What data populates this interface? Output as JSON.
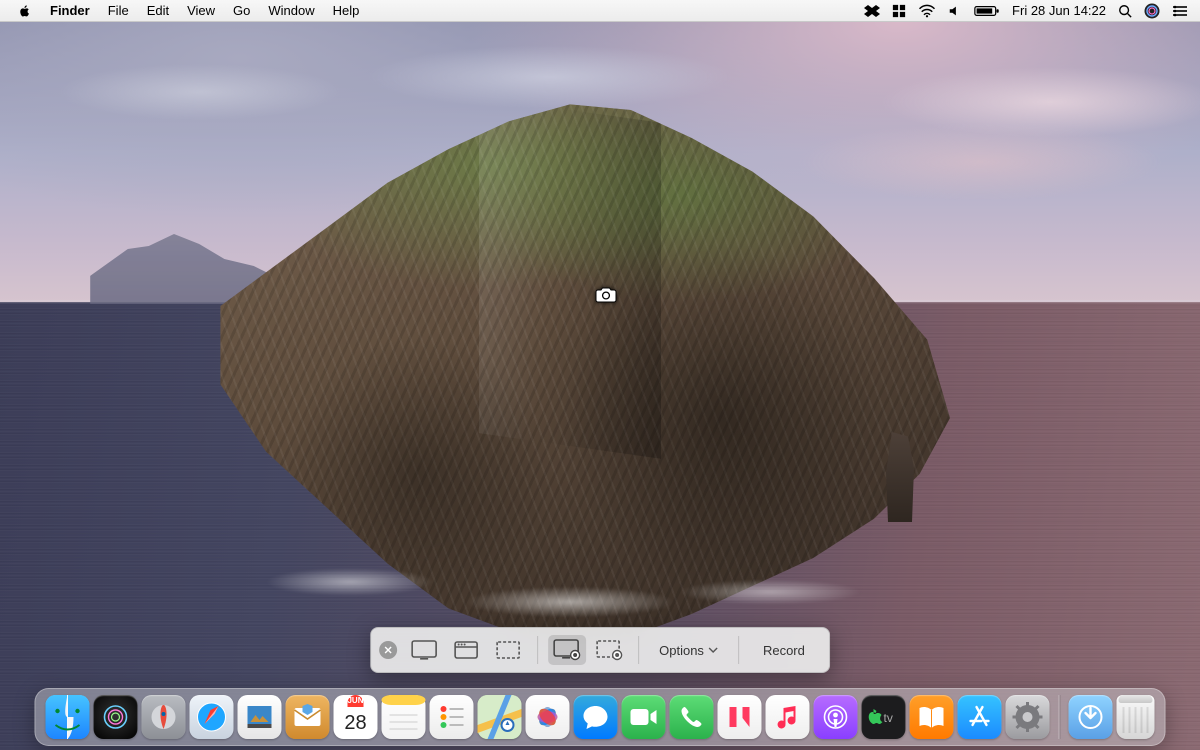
{
  "menubar": {
    "app": "Finder",
    "items": [
      "File",
      "Edit",
      "View",
      "Go",
      "Window",
      "Help"
    ],
    "datetime": "Fri 28 Jun  14:22"
  },
  "screenshot_toolbar": {
    "options_label": "Options",
    "action_label": "Record",
    "selected_mode": "record-entire-screen"
  },
  "calendar_tile": {
    "month": "JUN",
    "day": "28"
  },
  "dock": {
    "apps": [
      "finder",
      "siri",
      "launchpad",
      "safari",
      "preview",
      "mail",
      "calendar",
      "notes",
      "reminders",
      "maps",
      "photos",
      "messages",
      "facetime",
      "phone",
      "news",
      "music",
      "podcasts",
      "tv",
      "books",
      "app-store",
      "system-preferences"
    ],
    "extras": [
      "downloads",
      "trash"
    ]
  }
}
